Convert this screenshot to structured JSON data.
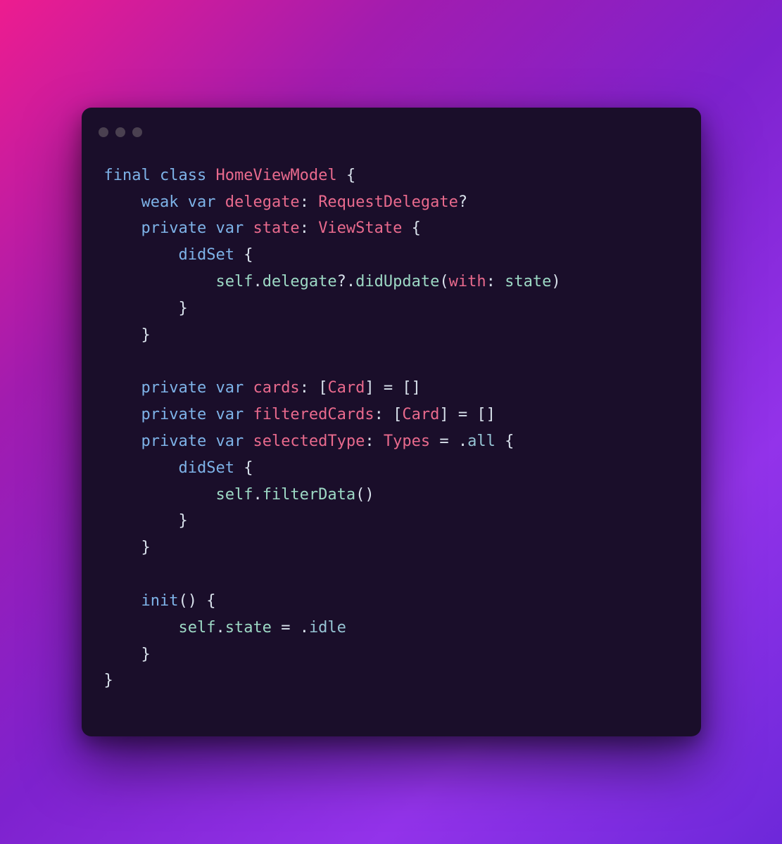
{
  "window": {
    "traffic_light_count": 3
  },
  "code": {
    "language": "swift",
    "tokens": {
      "kw_final": "final",
      "kw_class": "class",
      "class_name": "HomeViewModel",
      "brace_open": "{",
      "brace_close": "}",
      "kw_weak": "weak",
      "kw_var": "var",
      "prop_delegate": "delegate",
      "colon": ":",
      "type_request_delegate": "RequestDelegate",
      "question": "?",
      "kw_private": "private",
      "prop_state": "state",
      "type_view_state": "ViewState",
      "kw_didset": "didSet",
      "kw_self": "self",
      "dot": ".",
      "method_didupdate": "didUpdate",
      "paren_open": "(",
      "paren_close": ")",
      "arg_with": "with",
      "arg_state": "state",
      "prop_cards": "cards",
      "type_card": "Card",
      "bracket_open": "[",
      "bracket_close": "]",
      "equals": "=",
      "empty_array": "[]",
      "prop_filteredcards": "filteredCards",
      "prop_selectedtype": "selectedType",
      "type_types": "Types",
      "enum_all": "all",
      "method_filterdata": "filterData",
      "kw_init": "init",
      "enum_idle": "idle"
    }
  },
  "colors": {
    "bg_gradient_start": "#ed1c8f",
    "bg_gradient_end": "#6d28d9",
    "window_bg": "#1a0e2a",
    "keyword": "#7eb3e8",
    "type_identifier": "#e96a8d",
    "self_member": "#9dd9c5",
    "punctuation": "#d9e2ec"
  }
}
